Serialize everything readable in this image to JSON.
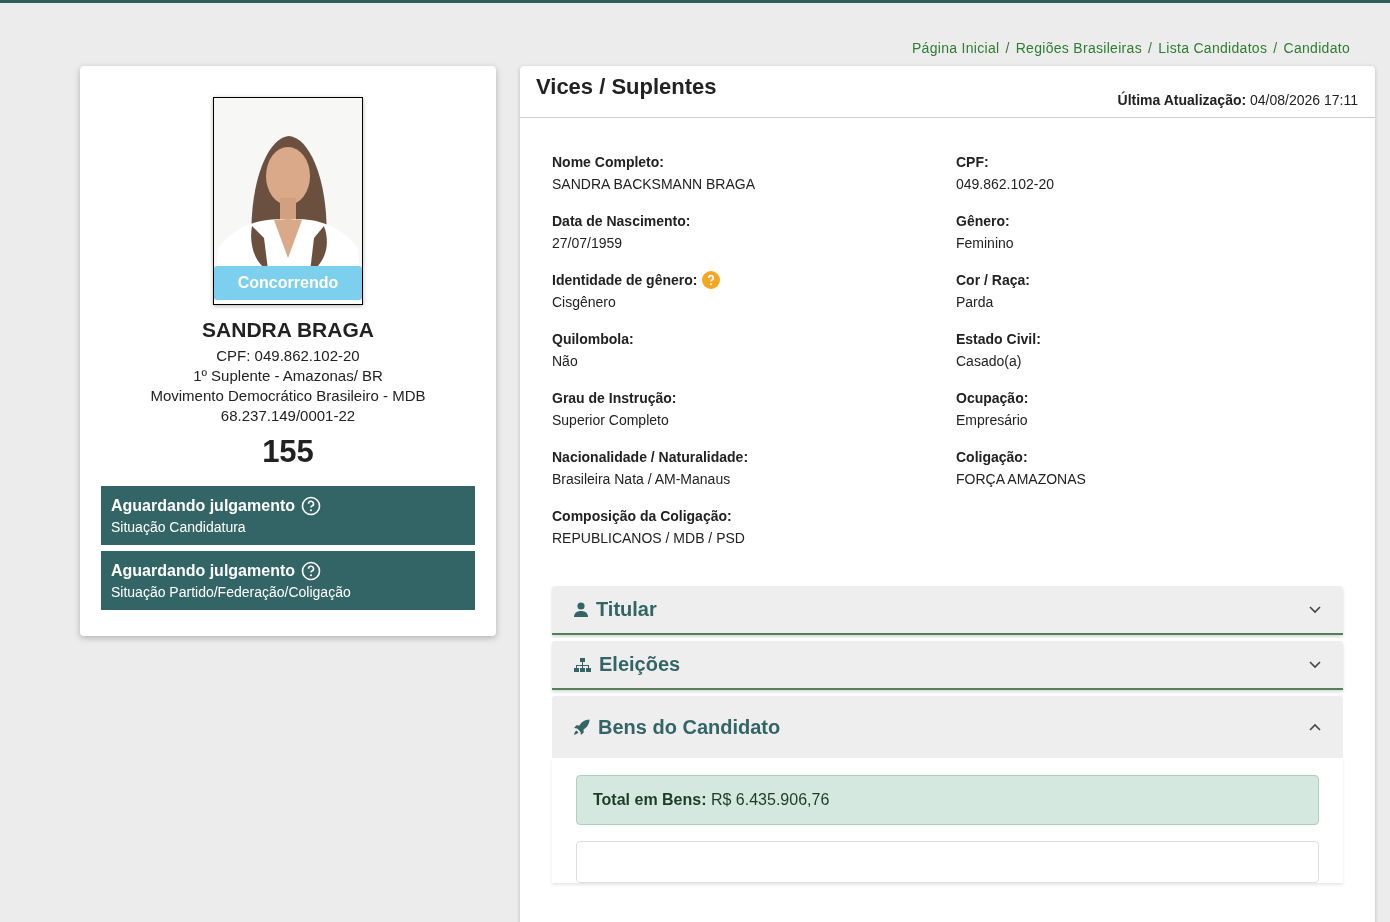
{
  "breadcrumb": {
    "separator": "/",
    "items": [
      {
        "label": "Página Inicial"
      },
      {
        "label": "Regiões Brasileiras"
      },
      {
        "label": "Lista Candidatos"
      },
      {
        "label": "Candidato"
      }
    ]
  },
  "candidate": {
    "badge": "Concorrendo",
    "name": "SANDRA BRAGA",
    "lines": [
      "CPF: 049.862.102-20",
      "1º Suplente - Amazonas/ BR",
      "Movimento Democrático Brasileiro - MDB",
      "68.237.149/0001-22"
    ],
    "number": "155",
    "statuses": [
      {
        "title": "Aguardando julgamento",
        "subtitle": "Situação Candidatura"
      },
      {
        "title": "Aguardando julgamento",
        "subtitle": "Situação Partido/Federação/Coligação"
      }
    ]
  },
  "panel": {
    "title": "Vices / Suplentes",
    "updated_label": "Última Atualização:",
    "updated_value": "04/08/2026 17:11",
    "fields": [
      {
        "label": "Nome Completo:",
        "value": "SANDRA BACKSMANN BRAGA",
        "help": false
      },
      {
        "label": "CPF:",
        "value": "049.862.102-20",
        "help": false
      },
      {
        "label": "Data de Nascimento:",
        "value": "27/07/1959",
        "help": false
      },
      {
        "label": "Gênero:",
        "value": "Feminino",
        "help": false
      },
      {
        "label": "Identidade de gênero:",
        "value": "Cisgênero",
        "help": true
      },
      {
        "label": "Cor / Raça:",
        "value": "Parda",
        "help": false
      },
      {
        "label": "Quilombola:",
        "value": "Não",
        "help": false
      },
      {
        "label": "Estado Civil:",
        "value": "Casado(a)",
        "help": false
      },
      {
        "label": "Grau de Instrução:",
        "value": "Superior Completo",
        "help": false
      },
      {
        "label": "Ocupação:",
        "value": "Empresário",
        "help": false
      },
      {
        "label": "Nacionalidade / Naturalidade:",
        "value": "Brasileira Nata / AM-Manaus",
        "help": false
      },
      {
        "label": "Coligação:",
        "value": "FORÇA AMAZONAS",
        "help": false
      },
      {
        "label": "Composição da Coligação:",
        "value": "REPUBLICANOS / MDB / PSD",
        "help": false
      }
    ],
    "accordions": [
      {
        "title": "Titular",
        "kind": "person",
        "expanded": false
      },
      {
        "title": "Eleições",
        "kind": "sitemap",
        "expanded": false
      },
      {
        "title": "Bens do Candidato",
        "kind": "rocket",
        "expanded": true,
        "total_label": "Total em Bens:",
        "total_value": "R$ 6.435.906,76"
      }
    ]
  }
}
